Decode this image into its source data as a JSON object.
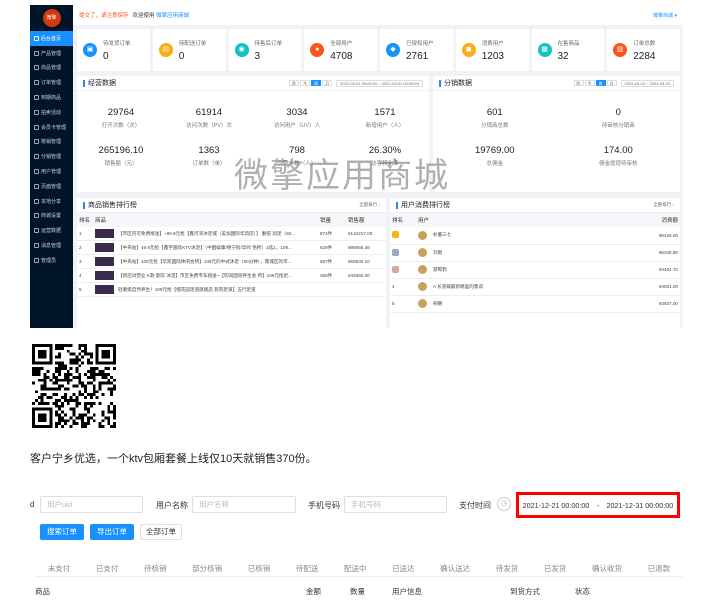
{
  "app": {
    "logo_text": "微擎",
    "warning": "提交了，请注意保存",
    "welcome": "欢迎使用",
    "shop_name": "微擎应用商城",
    "user": "微擎商城 ▾"
  },
  "sidebar": {
    "items": [
      {
        "label": "后台首页",
        "active": true
      },
      {
        "label": "产品管理"
      },
      {
        "label": "商品管理"
      },
      {
        "label": "订单管理"
      },
      {
        "label": "到期商品"
      },
      {
        "label": "拍卖活动"
      },
      {
        "label": "会员卡管理"
      },
      {
        "label": "核销管理"
      },
      {
        "label": "分销管理"
      },
      {
        "label": "用户管理"
      },
      {
        "label": "页面管理"
      },
      {
        "label": "本地分享"
      },
      {
        "label": "商城设置"
      },
      {
        "label": "运营数据"
      },
      {
        "label": "消息管理"
      },
      {
        "label": "管理员"
      }
    ]
  },
  "stat_cards": [
    {
      "label": "待发货订单",
      "value": "0",
      "color": "#1890ff"
    },
    {
      "label": "待配送订单",
      "value": "0",
      "color": "#faad14"
    },
    {
      "label": "待售后订单",
      "value": "3",
      "color": "#13c2c2"
    },
    {
      "label": "全部用户",
      "value": "4708",
      "color": "#fa541c"
    },
    {
      "label": "已授权用户",
      "value": "2761",
      "color": "#1890ff"
    },
    {
      "label": "消费用户",
      "value": "1203",
      "color": "#faad14"
    },
    {
      "label": "在售商品",
      "value": "32",
      "color": "#13c2c2"
    },
    {
      "label": "订单总数",
      "value": "2284",
      "color": "#fa541c"
    }
  ],
  "operations": {
    "title": "经营数据",
    "tabs": [
      "昨",
      "今",
      "周",
      "月"
    ],
    "active_tab": 2,
    "date_range": "2022-03-01 00:00:00 ~ 2022-03-01 00:00:00",
    "stats": [
      {
        "value": "29764",
        "label": "打开次数（次）"
      },
      {
        "value": "61914",
        "label": "访问次数（PV）次"
      },
      {
        "value": "3034",
        "label": "访问用户（UV）人"
      },
      {
        "value": "1571",
        "label": "新增用户（人）"
      },
      {
        "value": "265196.10",
        "label": "销售额（元）"
      },
      {
        "value": "1363",
        "label": "订单数（单）"
      },
      {
        "value": "798",
        "label": "付款人数（人）"
      },
      {
        "value": "26.30%",
        "label": "访客转化率"
      }
    ]
  },
  "distribution": {
    "title": "分销数据",
    "tabs": [
      "昨",
      "今",
      "周",
      "月"
    ],
    "active_tab": 2,
    "date_range": "2022-03-23 ~ 2022-03-23",
    "stats": [
      {
        "value": "601",
        "label": "分销商总数"
      },
      {
        "value": "0",
        "label": "待审核分销商"
      },
      {
        "value": "19769.00",
        "label": "总佣金"
      },
      {
        "value": "174.00",
        "label": "佣金提现待审核"
      }
    ]
  },
  "watermark": "微擎应用商城",
  "goods_rank": {
    "title": "商品销售排行榜",
    "more": "全部排行 ›",
    "headers": [
      "排名",
      "商品",
      "销量",
      "销售额"
    ],
    "rows": [
      {
        "rank": "1",
        "name": "【市区内可免费接送】~99.9元抢【鑫河湾沐足城（美加国际华韵店）】 翻倍 润足（60...",
        "sales": "874件",
        "amount": "¥134217.00"
      },
      {
        "rank": "2",
        "name": "【中央站】49.9元抢【鑫宇国际KTV沐足】（中国娱康/德宁街/华鸣 悟所）3选1，109...",
        "sales": "629件",
        "amount": "¥98655.49"
      },
      {
        "rank": "3",
        "name": "【中央站】109元抢【华凯国际休闲会所】109元的中式沐足（60分钟），需城区的市...",
        "sales": "587件",
        "amount": "¥59630.10"
      },
      {
        "rank": "4",
        "name": "【新店试营业 K歌 影院 沐足】市区免费专车接送~【钧润国际养生会 所】109元抢足...",
        "sales": "358件",
        "amount": "¥49392.00"
      },
      {
        "rank": "5",
        "name": "轻奢级自然养生！109元抢【缦花园足道旗舰店 影院足道】五行足道",
        "sales": "",
        "amount": ""
      }
    ]
  },
  "user_rank": {
    "title": "用户消费排行榜",
    "more": "全部排行 ›",
    "headers": [
      "排名",
      "用户",
      "消费额"
    ],
    "rows": [
      {
        "rank": "",
        "name": "杉董三七",
        "amount": "¥6426.00",
        "medal": "#f5b31e"
      },
      {
        "rank": "",
        "name": "刘雨",
        "amount": "¥6348.80",
        "medal": "#9aa9c0"
      },
      {
        "rank": "",
        "name": "游鹭鸦",
        "amount": "¥4454.70",
        "medal": "#d9a7a1"
      },
      {
        "rank": "4",
        "name": "A 长泥鎮最新哪里的鲁谅",
        "amount": "¥4031.00",
        "medal": ""
      },
      {
        "rank": "5",
        "name": "枳朝",
        "amount": "¥3937.00",
        "medal": ""
      }
    ]
  },
  "caption": "客户宁乡优选，一个ktv包厢套餐上线仅10天就销售370份。",
  "order_filter": {
    "uid_label": "d",
    "uid_placeholder": "用户uid",
    "name_label": "用户名称",
    "name_placeholder": "用户名称",
    "phone_label": "手机号码",
    "phone_placeholder": "手机号码",
    "paytime_label": "支付时间",
    "date_start": "2021-12-21 00:00:00",
    "date_sep": "-",
    "date_end": "2021-12-31 00:00:00",
    "highlight_color": "#ff0000",
    "search_btn": "搜索订单",
    "export_btn": "导出订单",
    "all_btn": "全部订单",
    "status_tabs": [
      "未支付",
      "已支付",
      "待核销",
      "部分核销",
      "已核销",
      "待配送",
      "配送中",
      "已送达",
      "确认送达",
      "待发货",
      "已发货",
      "确认收货",
      "已退款"
    ],
    "columns": [
      "商品",
      "金额",
      "数量",
      "用户信息",
      "到货方式",
      "状态"
    ]
  }
}
